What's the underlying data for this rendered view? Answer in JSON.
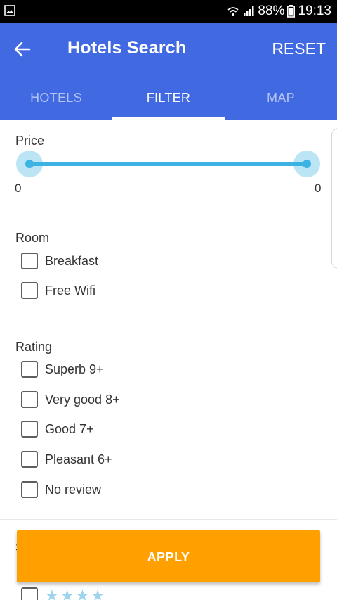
{
  "status_bar": {
    "battery": "88%",
    "time": "19:13",
    "icons": [
      "image-icon",
      "wifi-icon",
      "signal-icon",
      "battery-icon"
    ]
  },
  "app_bar": {
    "title": "Hotels Search",
    "reset_label": "RESET",
    "color": "#4169e1"
  },
  "tabs": [
    {
      "label": "HOTELS",
      "active": false
    },
    {
      "label": "FILTER",
      "active": true
    },
    {
      "label": "MAP",
      "active": false
    }
  ],
  "price": {
    "label": "Price",
    "min_value": "0",
    "max_value": "0",
    "accent": "#3db3e3"
  },
  "room": {
    "label": "Room",
    "options": [
      {
        "label": "Breakfast",
        "checked": false
      },
      {
        "label": "Free Wifi",
        "checked": false
      }
    ]
  },
  "rating": {
    "label": "Rating",
    "options": [
      {
        "label": "Superb 9+",
        "checked": false
      },
      {
        "label": "Very good 8+",
        "checked": false
      },
      {
        "label": "Good 7+",
        "checked": false
      },
      {
        "label": "Pleasant 6+",
        "checked": false
      },
      {
        "label": "No review",
        "checked": false
      }
    ]
  },
  "stars_section": {
    "label_partial": "S",
    "first_option_stars": 4
  },
  "apply": {
    "label": "APPLY",
    "color": "#ffa000"
  }
}
